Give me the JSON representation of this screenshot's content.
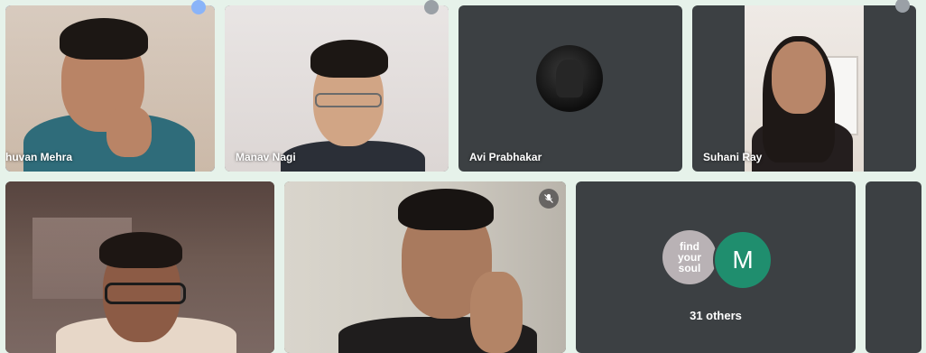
{
  "participants": [
    {
      "name": "huvan Mehra"
    },
    {
      "name": "Manav Nagi"
    },
    {
      "name": "Avi Prabhakar"
    },
    {
      "name": "Suhani Ray"
    },
    {
      "name": ""
    },
    {
      "name": ""
    }
  ],
  "others": {
    "count_label": "31 others",
    "avatar_letter": "M",
    "logo_text": "find your soul"
  },
  "colors": {
    "tile_bg": "#3c4043",
    "active_border": "#4c8df6",
    "avatar_m": "#1f8e6e",
    "page_bg": "#e6f2ea"
  },
  "icons": [
    "mic-off-icon",
    "more-options-icon"
  ]
}
